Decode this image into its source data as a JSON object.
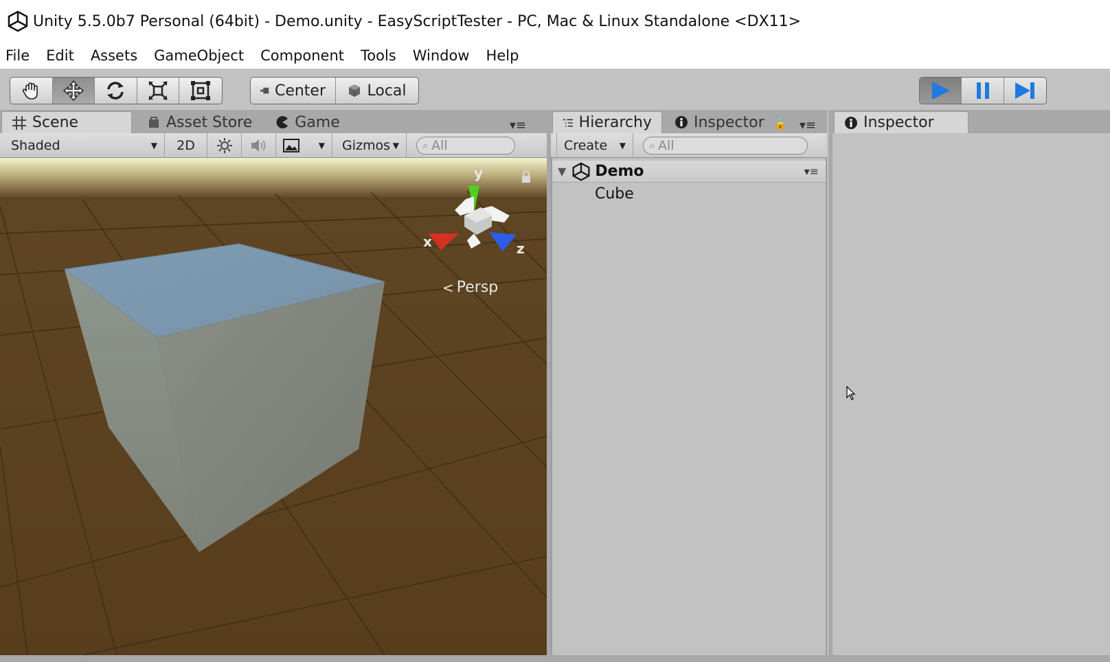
{
  "window": {
    "title": "Unity 5.5.0b7 Personal (64bit) - Demo.unity - EasyScriptTester - PC, Mac & Linux Standalone <DX11>"
  },
  "menu": [
    {
      "label": "File"
    },
    {
      "label": "Edit"
    },
    {
      "label": "Assets"
    },
    {
      "label": "GameObject"
    },
    {
      "label": "Component"
    },
    {
      "label": "Tools"
    },
    {
      "label": "Window"
    },
    {
      "label": "Help"
    }
  ],
  "toolbar": {
    "tools": [
      {
        "icon": "hand-icon",
        "active": false
      },
      {
        "icon": "move-icon",
        "active": true
      },
      {
        "icon": "rotate-icon",
        "active": false
      },
      {
        "icon": "scale-icon",
        "active": false
      },
      {
        "icon": "rect-icon",
        "active": false
      }
    ],
    "pivot_label": "Center",
    "space_label": "Local",
    "play_controls": [
      "play-icon",
      "pause-icon",
      "step-icon"
    ]
  },
  "scene_panel": {
    "tabs": [
      {
        "label": "Scene",
        "icon": "grid-icon",
        "active": true
      },
      {
        "label": "Asset Store",
        "icon": "bag-icon",
        "active": false
      },
      {
        "label": "Game",
        "icon": "pacman-icon",
        "active": false
      }
    ],
    "shading_mode": "Shaded",
    "mode_2d": "2D",
    "gizmos_label": "Gizmos",
    "search_placeholder": "All",
    "axes": {
      "x": "x",
      "y": "y",
      "z": "z"
    },
    "projection": "Persp"
  },
  "hierarchy_panel": {
    "tabs": [
      {
        "label": "Hierarchy",
        "icon": "list-icon",
        "active": true
      },
      {
        "label": "Inspector",
        "icon": "info-icon",
        "active": false
      }
    ],
    "create_label": "Create",
    "search_placeholder": "All",
    "scene_name": "Demo",
    "objects": [
      "Cube"
    ]
  },
  "inspector_panel": {
    "tabs": [
      {
        "label": "Inspector",
        "icon": "info-icon",
        "active": true
      }
    ]
  },
  "colors": {
    "editor_bg": "#c2c2c2",
    "play_blue": "#1f7ae0",
    "ground": "#5a4020",
    "sky": "#f4f3cc",
    "axis_x": "#d83020",
    "axis_y": "#4ccf1f",
    "axis_z": "#2c5de8"
  }
}
